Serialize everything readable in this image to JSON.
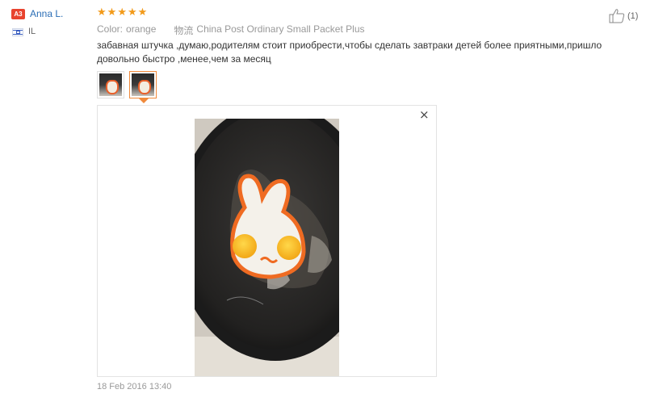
{
  "user": {
    "badge": "A3",
    "name": "Anna L.",
    "country": "IL"
  },
  "rating": {
    "stars": 5,
    "max": 5
  },
  "meta": {
    "color_label": "Color:",
    "color_value": "orange",
    "shipping_label": "物流",
    "shipping_value": "China Post Ordinary Small Packet Plus"
  },
  "like": {
    "count": "(1)"
  },
  "review": {
    "text": "забавная штучка ,думаю,родителям стоит приобрести,чтобы сделать завтраки детей более приятными,пришло довольно быстро ,менее,чем за месяц"
  },
  "thumbnails": {
    "count": 2,
    "selected_index": 1
  },
  "viewer": {
    "close_label": "×"
  },
  "date": "18 Feb 2016 13:40",
  "colors": {
    "star": "#f29a1a",
    "accent": "#f08a3c",
    "name_link": "#2a6db5",
    "badge": "#e8432e"
  }
}
